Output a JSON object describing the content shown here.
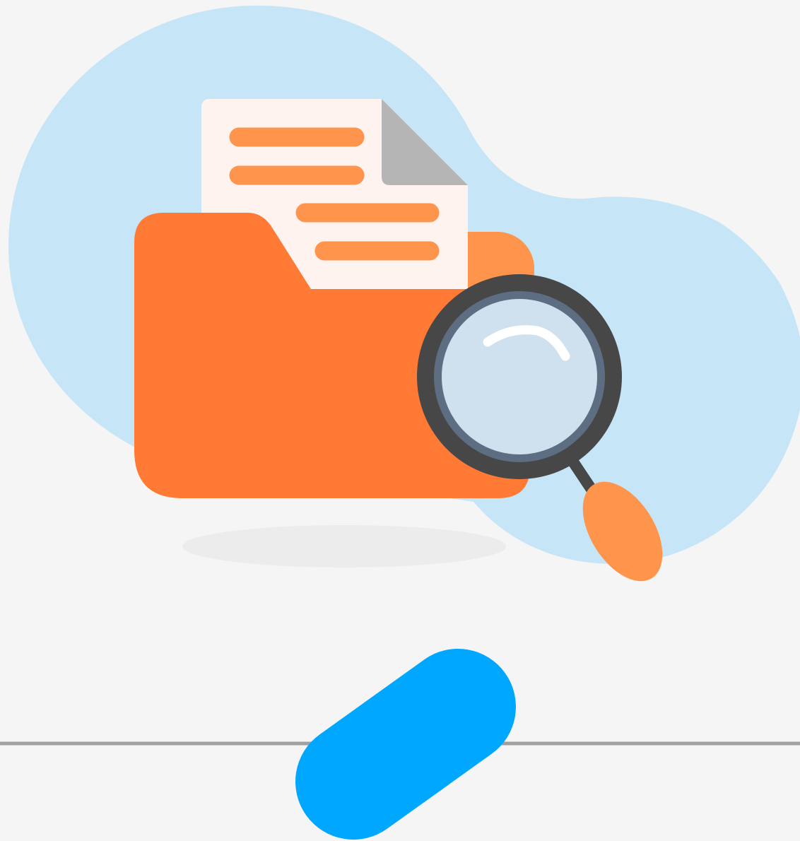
{
  "illustration": {
    "subject": "folder-search-empty-state",
    "icons": [
      "background-blob-icon",
      "folder-icon",
      "document-icon",
      "magnifying-glass-icon",
      "scroll-handle-icon"
    ]
  },
  "colors": {
    "page_background": "#f5f5f5",
    "blob": "#c6e6f7",
    "folder_front": "#ff7a35",
    "folder_back": "#ff944d",
    "document_paper": "#fef3ee",
    "document_fold": "#b5b5b5",
    "document_lines": "#ff944d",
    "lens_rim": "#474747",
    "lens_inner_ring": "#5d6d82",
    "lens_glass": "#cfe1ef",
    "lens_glare": "#ffffff",
    "magnifier_handle": "#ff944d",
    "shadow": "#ececec",
    "divider_line": "#a0a0a0",
    "scroll_handle": "#00a7ff"
  }
}
